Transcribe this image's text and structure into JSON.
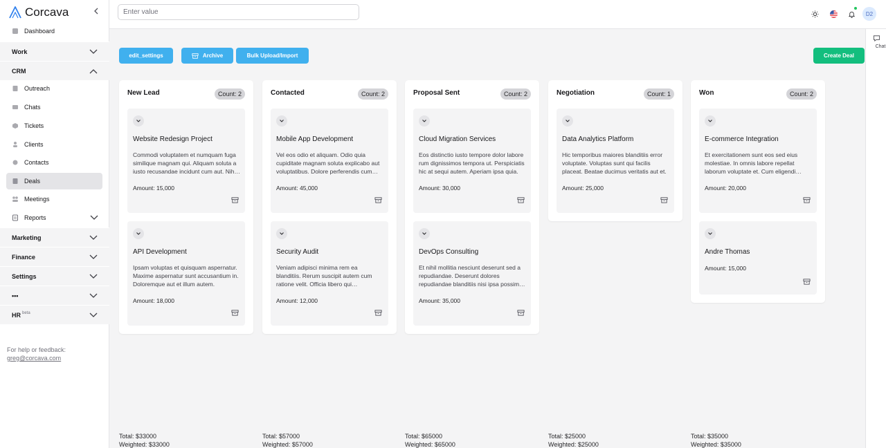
{
  "brand": {
    "name": "Corcava",
    "accent": "#2f80ed"
  },
  "sidebar": {
    "top_items": [
      {
        "label": "Dashboard",
        "icon": "dashboard-icon"
      }
    ],
    "groups": [
      {
        "label": "Work",
        "expanded": false
      },
      {
        "label": "CRM",
        "expanded": true
      }
    ],
    "crm_items": [
      {
        "label": "Outreach",
        "icon": "outreach-icon"
      },
      {
        "label": "Chats",
        "icon": "chats-icon"
      },
      {
        "label": "Tickets",
        "icon": "tickets-icon"
      },
      {
        "label": "Clients",
        "icon": "clients-icon"
      },
      {
        "label": "Contacts",
        "icon": "contacts-icon"
      },
      {
        "label": "Deals",
        "icon": "deals-icon",
        "active": true
      },
      {
        "label": "Meetings",
        "icon": "meetings-icon"
      },
      {
        "label": "Reports",
        "icon": "reports-icon"
      }
    ],
    "lower_groups": [
      "Marketing",
      "Finance",
      "Settings",
      "•••",
      "HR"
    ],
    "hr_badge": "beta",
    "help_text": "For help or feedback:",
    "help_email": "greg@corcava.com"
  },
  "topbar": {
    "search_placeholder": "Enter value",
    "avatar_initials": "D2"
  },
  "chat": {
    "label": "Chat"
  },
  "toolbar": {
    "edit_settings": "edit_settings",
    "archive": "Archive",
    "bulk_upload": "Bulk Upload/Import",
    "create_deal": "Create Deal"
  },
  "board": {
    "columns": [
      {
        "title": "New Lead",
        "count": "Count: 2",
        "total": "Total: $33000",
        "weighted": "Weighted: $33000",
        "cards": [
          {
            "title": "Website Redesign Project",
            "desc": "Commodi voluptatem et numquam fuga similique magnam qui. Aliquam soluta a iusto recusandae incidunt cum aut. Nihil quis voluptas.",
            "amount": "Amount: 15,000"
          },
          {
            "title": "API Development",
            "desc": "Ipsam voluptas et quisquam aspernatur. Maxime aspernatur sunt accusantium in. Doloremque aut et illum autem.",
            "amount": "Amount: 18,000"
          }
        ]
      },
      {
        "title": "Contacted",
        "count": "Count: 2",
        "total": "Total: $57000",
        "weighted": "Weighted: $57000",
        "cards": [
          {
            "title": "Mobile App Development",
            "desc": "Vel eos odio et aliquam. Odio quia cupiditate magnam soluta explicabo aut voluptatibus. Dolore perferendis cum quia.",
            "amount": "Amount: 45,000"
          },
          {
            "title": "Security Audit",
            "desc": "Veniam adipisci minima rem ea blanditiis. Rerum suscipit autem cum ratione velit. Officia libero qui consequatur et ut.",
            "amount": "Amount: 12,000"
          }
        ]
      },
      {
        "title": "Proposal Sent",
        "count": "Count: 2",
        "total": "Total: $65000",
        "weighted": "Weighted: $65000",
        "cards": [
          {
            "title": "Cloud Migration Services",
            "desc": "Eos distinctio iusto tempore dolor labore rum dignissimos tempora ut. Perspiciatis hic at sequi autem. Aperiam ipsa quia.",
            "amount": "Amount: 30,000"
          },
          {
            "title": "DevOps Consulting",
            "desc": "Et nihil mollitia nesciunt deserunt sed a repudiandae. Deserunt dolores repudiandae blanditiis nisi ipsa possimus et.",
            "amount": "Amount: 35,000"
          }
        ]
      },
      {
        "title": "Negotiation",
        "count": "Count: 1",
        "total": "Total: $25000",
        "weighted": "Weighted: $25000",
        "cards": [
          {
            "title": "Data Analytics Platform",
            "desc": "Hic temporibus maiores blanditiis error voluptate. Voluptas sunt qui facilis placeat. Beatae ducimus veritatis aut et.",
            "amount": "Amount: 25,000"
          }
        ]
      },
      {
        "title": "Won",
        "count": "Count: 2",
        "total": "Total: $35000",
        "weighted": "Weighted: $35000",
        "cards": [
          {
            "title": "E-commerce Integration",
            "desc": "Et exercitationem sunt eos sed eius molestiae. In omnis labore repellat laborum voluptate et. Cum eligendi repellat quod.",
            "amount": "Amount: 20,000"
          },
          {
            "title": "Andre Thomas",
            "desc": "",
            "amount": "Amount: 15,000"
          }
        ]
      }
    ]
  }
}
